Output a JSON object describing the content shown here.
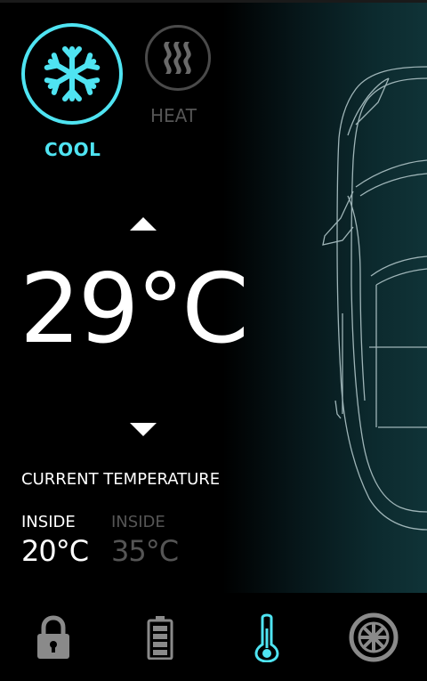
{
  "modes": [
    {
      "label": "COOL",
      "icon": "snowflake-icon",
      "active": true
    },
    {
      "label": "HEAT",
      "icon": "heat-waves-icon",
      "active": false
    }
  ],
  "setpoint": {
    "value": "29°C"
  },
  "current": {
    "title": "CURRENT TEMPERATURE",
    "readings": [
      {
        "label": "INSIDE",
        "value": "20°C",
        "active": true
      },
      {
        "label": "INSIDE",
        "value": "35°C",
        "active": false
      }
    ]
  },
  "nav": [
    {
      "icon": "lock-icon",
      "active": false
    },
    {
      "icon": "battery-icon",
      "active": false
    },
    {
      "icon": "thermometer-icon",
      "active": true
    },
    {
      "icon": "wheel-icon",
      "active": false
    }
  ],
  "colors": {
    "accent": "#4fe4f2",
    "inactive": "#555555",
    "text": "#ffffff",
    "background": "#000000"
  }
}
